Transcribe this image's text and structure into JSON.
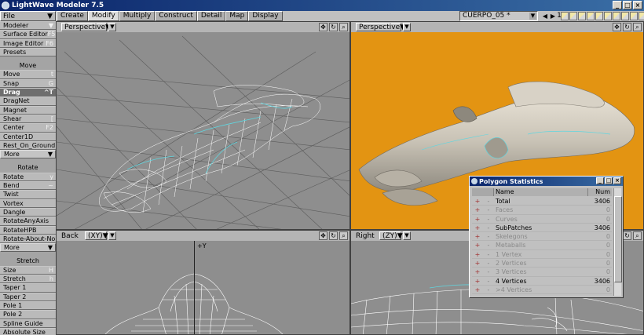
{
  "window": {
    "title": "LightWave Modeler 7.5",
    "buttons": [
      "_",
      "□",
      "×"
    ]
  },
  "toolbar": {
    "file_label": "File",
    "tabs": [
      {
        "label": "Create",
        "active": false
      },
      {
        "label": "Modify",
        "active": true
      },
      {
        "label": "Multiply",
        "active": false
      },
      {
        "label": "Construct",
        "active": false
      },
      {
        "label": "Detail",
        "active": false
      },
      {
        "label": "Map",
        "active": false
      },
      {
        "label": "Display",
        "active": false
      }
    ],
    "layer_object": "CUERPO_05 *",
    "layer_number": "1"
  },
  "sidebar": {
    "top": [
      {
        "label": "Modeler",
        "key": "▼"
      },
      {
        "label": "Surface Editor",
        "key": "F5"
      },
      {
        "label": "Image Editor",
        "key": "F6"
      },
      {
        "label": "Presets",
        "key": ""
      }
    ],
    "move_title": "Move",
    "move_items": [
      {
        "label": "Move",
        "key": "t",
        "selected": false
      },
      {
        "label": "Snap",
        "key": "G",
        "selected": false
      },
      {
        "label": "Drag",
        "key": "^T",
        "selected": true
      },
      {
        "label": "DragNet",
        "key": "",
        "selected": false
      },
      {
        "label": "Magnet",
        "key": "",
        "selected": false
      },
      {
        "label": "Shear",
        "key": "[",
        "selected": false
      },
      {
        "label": "Center",
        "key": "F2",
        "selected": false
      },
      {
        "label": "Center1D",
        "key": "",
        "selected": false
      },
      {
        "label": "Rest_On_Ground",
        "key": "",
        "selected": false
      }
    ],
    "more_label": "More",
    "rotate_title": "Rotate",
    "rotate_items": [
      {
        "label": "Rotate",
        "key": "y"
      },
      {
        "label": "Bend",
        "key": "~"
      },
      {
        "label": "Twist",
        "key": ""
      },
      {
        "label": "Vortex",
        "key": ""
      },
      {
        "label": "Dangle",
        "key": ""
      },
      {
        "label": "RotateAnyAxis",
        "key": ""
      },
      {
        "label": "RotateHPB",
        "key": ""
      },
      {
        "label": "Rotate-About-No...",
        "key": ""
      }
    ],
    "stretch_title": "Stretch",
    "stretch_items": [
      {
        "label": "Size",
        "key": "H"
      },
      {
        "label": "Stretch",
        "key": "h"
      },
      {
        "label": "Taper 1",
        "key": ""
      },
      {
        "label": "Taper 2",
        "key": ""
      },
      {
        "label": "Pole 1",
        "key": ""
      },
      {
        "label": "Pole 2",
        "key": ""
      },
      {
        "label": "Spline Guide",
        "key": ""
      },
      {
        "label": "Absolute Size",
        "key": ""
      }
    ]
  },
  "viewports": {
    "top_left": {
      "view": "Perspective"
    },
    "top_right": {
      "view": "Perspective",
      "background": "#e39412"
    },
    "bottom_left": {
      "view": "Back",
      "axes": "(XY)",
      "axis_label": "+Y"
    },
    "bottom_right": {
      "view": "Right",
      "axes": "(ZY)"
    }
  },
  "polygon_stats": {
    "title": "Polygon Statistics",
    "col_name": "Name",
    "col_num": "Num",
    "rows": [
      {
        "name": "Total",
        "value": "3406",
        "dim": false
      },
      {
        "name": "Faces",
        "value": "0",
        "dim": true
      },
      {
        "name": "Curves",
        "value": "0",
        "dim": true
      },
      {
        "name": "SubPatches",
        "value": "3406",
        "dim": false
      },
      {
        "name": "Skelegons",
        "value": "0",
        "dim": true
      },
      {
        "name": "Metaballs",
        "value": "0",
        "dim": true
      },
      {
        "name": "1 Vertex",
        "value": "0",
        "dim": true
      },
      {
        "name": "2 Vertices",
        "value": "0",
        "dim": true
      },
      {
        "name": "3 Vertices",
        "value": "0",
        "dim": true
      },
      {
        "name": "4 Vertices",
        "value": "3406",
        "dim": false
      },
      {
        "name": ">4 Vertices",
        "value": "0",
        "dim": true
      }
    ]
  }
}
